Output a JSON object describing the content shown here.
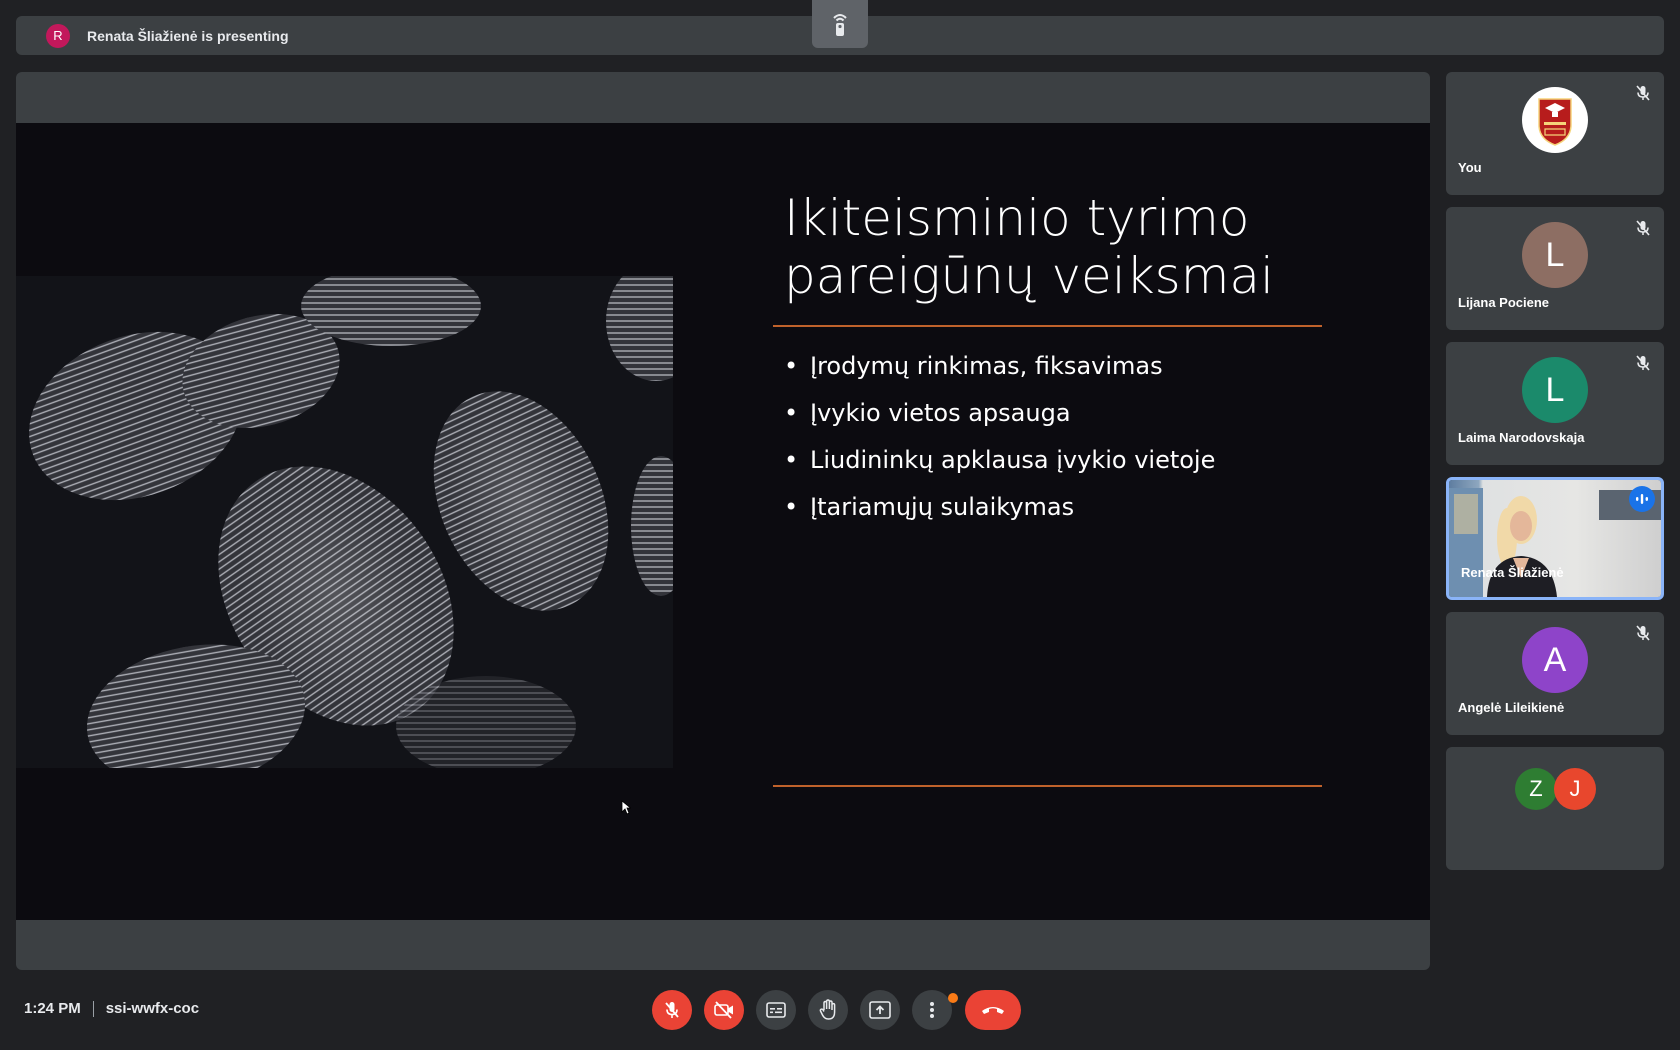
{
  "presenting_bar": {
    "avatar_initial": "R",
    "avatar_color": "#c2185b",
    "text": "Renata Šliažienė is presenting",
    "remote_icon": "remote-control-icon"
  },
  "slide": {
    "title": "Ikiteisminio tyrimo pareigūnų veiksmai",
    "bullets": [
      "Įrodymų rinkimas, fiksavimas",
      "Įvykio vietos apsauga",
      "Liudininkų apklausa įvykio vietoje",
      "Įtariamųjų sulaikymas"
    ],
    "accent_color": "#c0622b",
    "image": "fingerprints-photo"
  },
  "participants": [
    {
      "name": "You",
      "avatar": "logo",
      "muted": true
    },
    {
      "name": "Lijana Pociene",
      "initial": "L",
      "color": "#8d6e63",
      "muted": true
    },
    {
      "name": "Laima Narodovskaja",
      "initial": "L",
      "color": "#1b8a6b",
      "muted": true
    },
    {
      "name": "Renata Šliažienė",
      "video": true,
      "speaking": true
    },
    {
      "name": "Angelė Lileikienė",
      "initial": "A",
      "color": "#8e44c9",
      "muted": true
    }
  ],
  "others": [
    {
      "initial": "Z",
      "color": "#2e7d32"
    },
    {
      "initial": "J",
      "color": "#e8472d"
    }
  ],
  "meeting": {
    "time": "1:24 PM",
    "code": "ssi-wwfx-coc"
  },
  "controls": {
    "mic": "mic-off-icon",
    "camera": "camera-off-icon",
    "captions": "captions-icon",
    "raise_hand": "raise-hand-icon",
    "present": "present-screen-icon",
    "more": "more-options-icon",
    "leave": "leave-call-icon"
  }
}
